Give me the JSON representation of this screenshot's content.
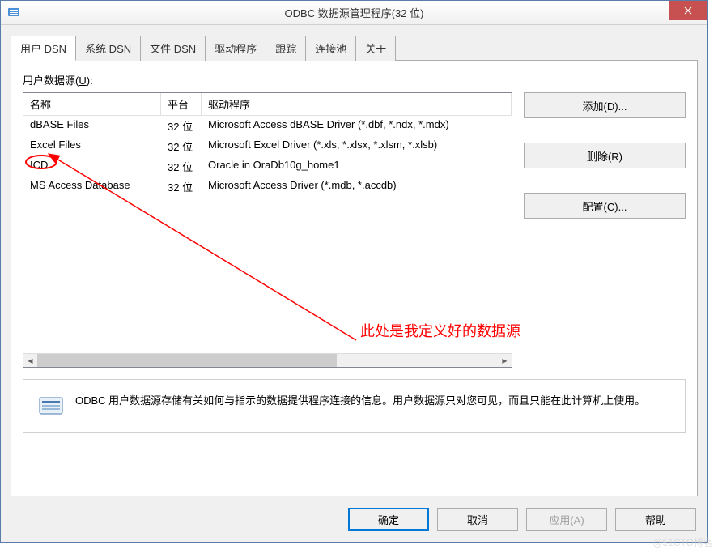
{
  "window": {
    "title": "ODBC 数据源管理程序(32 位)"
  },
  "tabs": [
    {
      "label": "用户 DSN",
      "active": true
    },
    {
      "label": "系统 DSN",
      "active": false
    },
    {
      "label": "文件 DSN",
      "active": false
    },
    {
      "label": "驱动程序",
      "active": false
    },
    {
      "label": "跟踪",
      "active": false
    },
    {
      "label": "连接池",
      "active": false
    },
    {
      "label": "关于",
      "active": false
    }
  ],
  "list": {
    "label_pre": "用户数据源(",
    "label_key": "U",
    "label_post": "):",
    "columns": [
      "名称",
      "平台",
      "驱动程序"
    ],
    "rows": [
      {
        "name": "dBASE Files",
        "platform": "32 位",
        "driver": "Microsoft Access dBASE Driver (*.dbf, *.ndx, *.mdx)"
      },
      {
        "name": "Excel Files",
        "platform": "32 位",
        "driver": "Microsoft Excel Driver (*.xls, *.xlsx, *.xlsm, *.xlsb)"
      },
      {
        "name": "ICD",
        "platform": "32 位",
        "driver": "Oracle in OraDb10g_home1"
      },
      {
        "name": "MS Access Database",
        "platform": "32 位",
        "driver": "Microsoft Access Driver (*.mdb, *.accdb)"
      }
    ]
  },
  "sidebar": {
    "add": "添加(D)...",
    "remove": "删除(R)",
    "config": "配置(C)..."
  },
  "info": {
    "text": "ODBC 用户数据源存储有关如何与指示的数据提供程序连接的信息。用户数据源只对您可见，而且只能在此计算机上使用。"
  },
  "buttons": {
    "ok": "确定",
    "cancel": "取消",
    "apply": "应用(A)",
    "help": "帮助"
  },
  "annotation": {
    "text": "此处是我定义好的数据源"
  },
  "watermark": "@51CTO博客"
}
